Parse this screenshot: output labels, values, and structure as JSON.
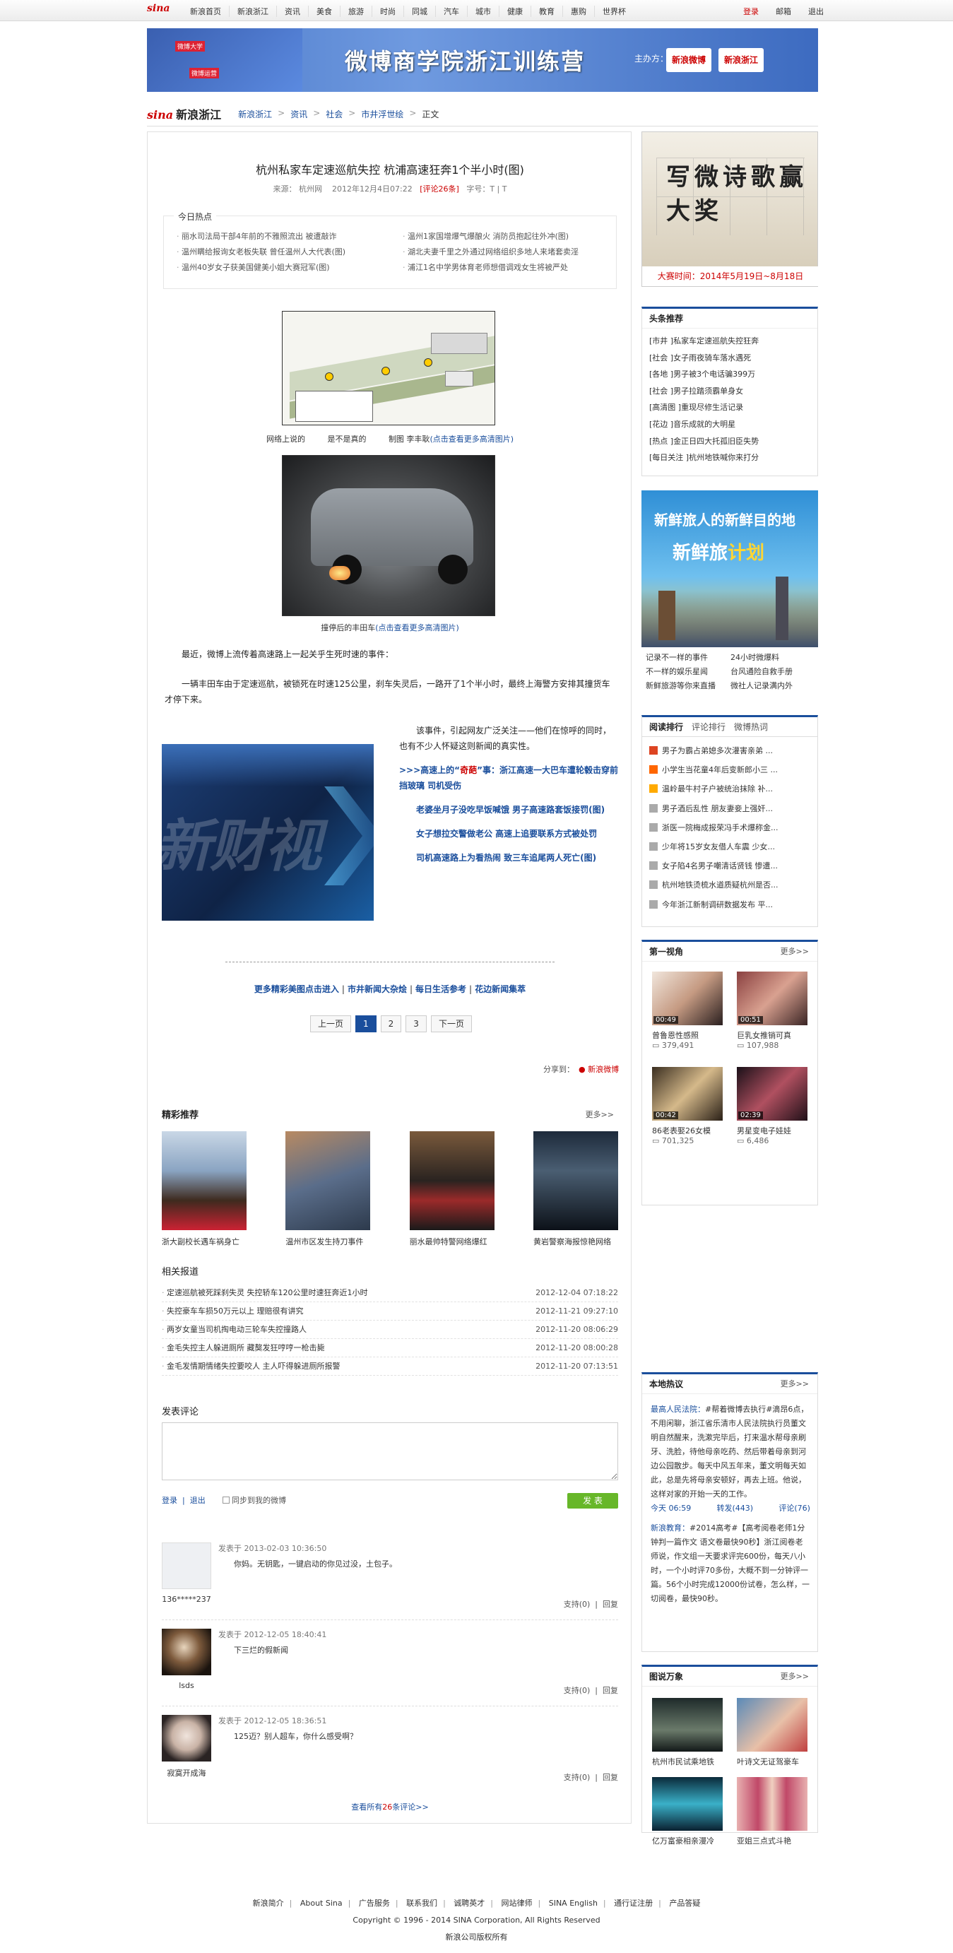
{
  "topnav": {
    "logo": "sina",
    "links": [
      "新浪首页",
      "新浪浙江",
      "资讯",
      "美食",
      "旅游",
      "时尚",
      "同城",
      "汽车",
      "城市",
      "健康",
      "教育",
      "惠购",
      "世界杯"
    ],
    "login": "登录",
    "mail": "邮箱",
    "logout": "退出"
  },
  "banner": {
    "left_tag1": "微博大学",
    "left_tag2": "微博运营",
    "title": "微博商学院浙江训练营",
    "org_label": "主办方：",
    "org1": "新浪微博",
    "org2": "新浪浙江"
  },
  "breadcrumb": {
    "brand": "sina",
    "brand_suffix": "新浪浙江",
    "items": [
      "新浪浙江",
      "资讯",
      "社会",
      "市井浮世绘"
    ],
    "current": "正文",
    "sep": ">"
  },
  "article": {
    "title": "杭州私家车定速巡航失控 杭浦高速狂奔1个半小时(图)",
    "meta_source_label": "来源：",
    "meta_source": "杭州网",
    "meta_date": "2012年12月4日07:22",
    "meta_comments": "[评论26条]",
    "meta_fontsize": "字号：T | T",
    "hot": {
      "title": "今日热点",
      "items": [
        "丽水司法局干部4年前的不雅照流出 被遭敲诈",
        "温州1家国增爆气爆酿火 消防员抱起往外冲(图)",
        "温州瞒给报询女老板失联 曾任温州人大代表(图)",
        "湖北夫妻千里之外通过网络组织多地人来堵套卖淫",
        "温州40岁女子获美国健美小姐大赛冠军(图)",
        "浦江1名中学男体育老师想借调戏女生将被严处"
      ]
    },
    "caption1_parts": [
      "网络上说的",
      "是不是真的",
      "制图 李丰耿"
    ],
    "caption1_link": "(点击查看更多高清图片)",
    "caption2_prefix": "撞停后的丰田车",
    "caption2_link": "(点击查看更多高清图片)",
    "para1": "最近，微博上流传着高速路上一起关乎生死时速的事件：",
    "para2": "一辆丰田车由于定速巡航，被锁死在时速125公里，刹车失灵后，一路开了1个半小时，最终上海警方安排其撞货车才停下来。",
    "right_para": "该事件，引起网友广泛关注——他们在惊呼的同时，也有不少人怀疑这则新闻的真实性。",
    "links": [
      {
        "pre": ">>>高速上的“",
        "red": "奇葩",
        "post": "”事：浙江高速一大巴车遭轮毂击穿前挡玻璃 司机受伤"
      },
      {
        "pre": "",
        "red": "",
        "post": "老婆坐月子没吃早饭喊饿 男子高速路套饭接罚(图)"
      },
      {
        "pre": "",
        "red": "",
        "post": "女子想拉交警做老公 高速上追要联系方式被处罚"
      },
      {
        "pre": "",
        "red": "",
        "post": "司机高速路上为看热闹 致三车追尾两人死亡(图)"
      }
    ],
    "video_text": "新财视",
    "more_links": [
      "更多精彩美图点击进入",
      "市井新闻大杂烩",
      "每日生活参考",
      "花边新闻集萃"
    ],
    "pager": {
      "prev": "上一页",
      "pages": [
        "1",
        "2",
        "3"
      ],
      "next": "下一页"
    },
    "share_label": "分享到：",
    "share_weibo": "新浪微博"
  },
  "recommend": {
    "title": "精彩推荐",
    "more": "更多>>",
    "items": [
      "浙大副校长遇车祸身亡",
      "温州市区发生持刀事件",
      "丽水最帅特警网络爆红",
      "黄岩警察海报惊艳网络"
    ]
  },
  "related": {
    "title": "相关报道",
    "items": [
      {
        "t": "定速巡航被死踩刹失灵 失控轿车120公里时速狂奔近1小时",
        "d": "2012-12-04 07:18:22"
      },
      {
        "t": "失控豪车车损50万元以上 理赔很有讲究",
        "d": "2012-11-21 09:27:10"
      },
      {
        "t": "两岁女童当司机掏电动三轮车失控撞路人",
        "d": "2012-11-20 08:06:29"
      },
      {
        "t": "金毛失控主人躲进厕所 藏獒发狂哼哼一枪击毙",
        "d": "2012-11-20 08:00:28"
      },
      {
        "t": "金毛发情期情绪失控要咬人 主人吓得躲进厕所报警",
        "d": "2012-11-20 07:13:51"
      }
    ]
  },
  "comments": {
    "title": "发表评论",
    "login": "登录",
    "logout": "退出",
    "sync": "同步到我的微博",
    "submit": "发 表",
    "support": "支持(0)",
    "reply": "回复",
    "list": [
      {
        "meta": "发表于 2013-02-03 10:36:50",
        "text": "你妈。无钥匙，一键启动的你见过没，土包子。",
        "user": "136*****237"
      },
      {
        "meta": "发表于 2012-12-05 18:40:41",
        "text": "下三烂的假新闻",
        "user": "lsds"
      },
      {
        "meta": "发表于 2012-12-05 18:36:51",
        "text": "125迈？别人超车，你什么感受啊？",
        "user": "寂寞开成海"
      }
    ],
    "all_prefix": "查看所有",
    "all_count": "26",
    "all_suffix": "条评论>>"
  },
  "sidebar": {
    "poetry_big": "写微诗歌赢大奖",
    "poetry_date": "大赛时间：2014年5月19日~8月18日",
    "headlines_title": "头条推荐",
    "headlines": [
      "[市井 ]私家车定速巡航失控狂奔",
      "[社会 ]女子雨夜骑车落水遇死",
      "[各地 ]男子被3个电话骗399万",
      "[社会 ]男子拉踏须霸单身女",
      "[高清图 ]重现尽修生活记录",
      "[花边 ]音乐成就的大明星",
      "[热点 ]金正日四大托孤旧臣失势",
      "[每日关注 ]杭州地铁喊你来打分"
    ],
    "travel_t1": "新鲜旅人的新鲜目的地",
    "travel_t2a": "新鲜旅",
    "travel_t2b": "计划",
    "travel_links": [
      "记录不一样的事件",
      "24小时微爆料",
      "不一样的娱乐星闻",
      "台风通险自救手册",
      "新鲜旅游等你来直播",
      "微社人记录满内外"
    ],
    "ranking_tabs": [
      "阅读排行",
      "评论排行",
      "微博热词"
    ],
    "ranking": [
      "男子为霸占弟媳多次灌害亲弟 ...",
      "小学生当花童4年后变新郎小三 ...",
      "温岭最牛村子户被统治抹除 补...",
      "男子酒后乱性 朋友妻妾上强奸...",
      "浙医一院梅成报荣冯手术爆称金...",
      "少年将15岁女友借人车震 少女...",
      "女子陷4名男子嘲清话贤钱 惨遭...",
      "杭州地铁烫梳水道质疑杭州是否...",
      "今年浙江新制调研数据发布 平..."
    ],
    "firstview_title": "第一视角",
    "firstview_more": "更多>>",
    "videos": [
      {
        "t": "曾鲁恩性感照",
        "d": "00:49",
        "c": "379,491"
      },
      {
        "t": "巨乳女推销可真",
        "d": "00:51",
        "c": "107,988"
      },
      {
        "t": "86老表娶26女模",
        "d": "00:42",
        "c": "701,325"
      },
      {
        "t": "男星变电子娃娃",
        "d": "02:39",
        "c": "6,486"
      }
    ],
    "local_title": "本地热议",
    "local_more": "更多>>",
    "local_items": [
      {
        "who": "最高人民法院：",
        "text": "#帮着微博去执行#滴昂6点，不用闲聊，浙江省乐清市人民法院执行员董文明自然醒来，洗漱完毕后，打来温水帮母亲刷牙、洗脸，待他母亲吃药、然后带着母亲到河边公园散步。每天中风五年来，董文明每天如此，总是先将母亲安顿好，再去上班。他说，这样对家的开始一天的工作。",
        "time": "今天 06:59",
        "fwd": "转发(443)",
        "cmt": "评论(76)"
      },
      {
        "who": "新浪教育：",
        "text": "#2014高考#【高考阅卷老师1分钟判一篇作文 语文卷最快90秒】浙江阅卷老师说，作文组一天要求评完600份，每天八小时，一个小时评70多份，大概不到一分钟评一篇。56个小时完成12000份试卷，怎么样，一切阅卷，最快90秒。"
      }
    ],
    "pics_title": "图说万象",
    "pics_more": "更多>>",
    "pics": [
      "杭州市民试乘地铁",
      "叶诗文无证驾豪车",
      "亿万富豪相亲漫冷",
      "亚姐三点式斗艳"
    ]
  },
  "footer": {
    "links": [
      "新浪简介",
      "About Sina",
      "广告服务",
      "联系我们",
      "诚聘英才",
      "网站律师",
      "SINA English",
      "通行证注册",
      "产品答疑"
    ],
    "copyright": "Copyright © 1996 - 2014 SINA Corporation, All Rights Reserved",
    "owner": "新浪公司版权所有"
  },
  "colors": {
    "link": "#1a4e9c",
    "accent": "#cc0000",
    "button": "#67b729"
  }
}
